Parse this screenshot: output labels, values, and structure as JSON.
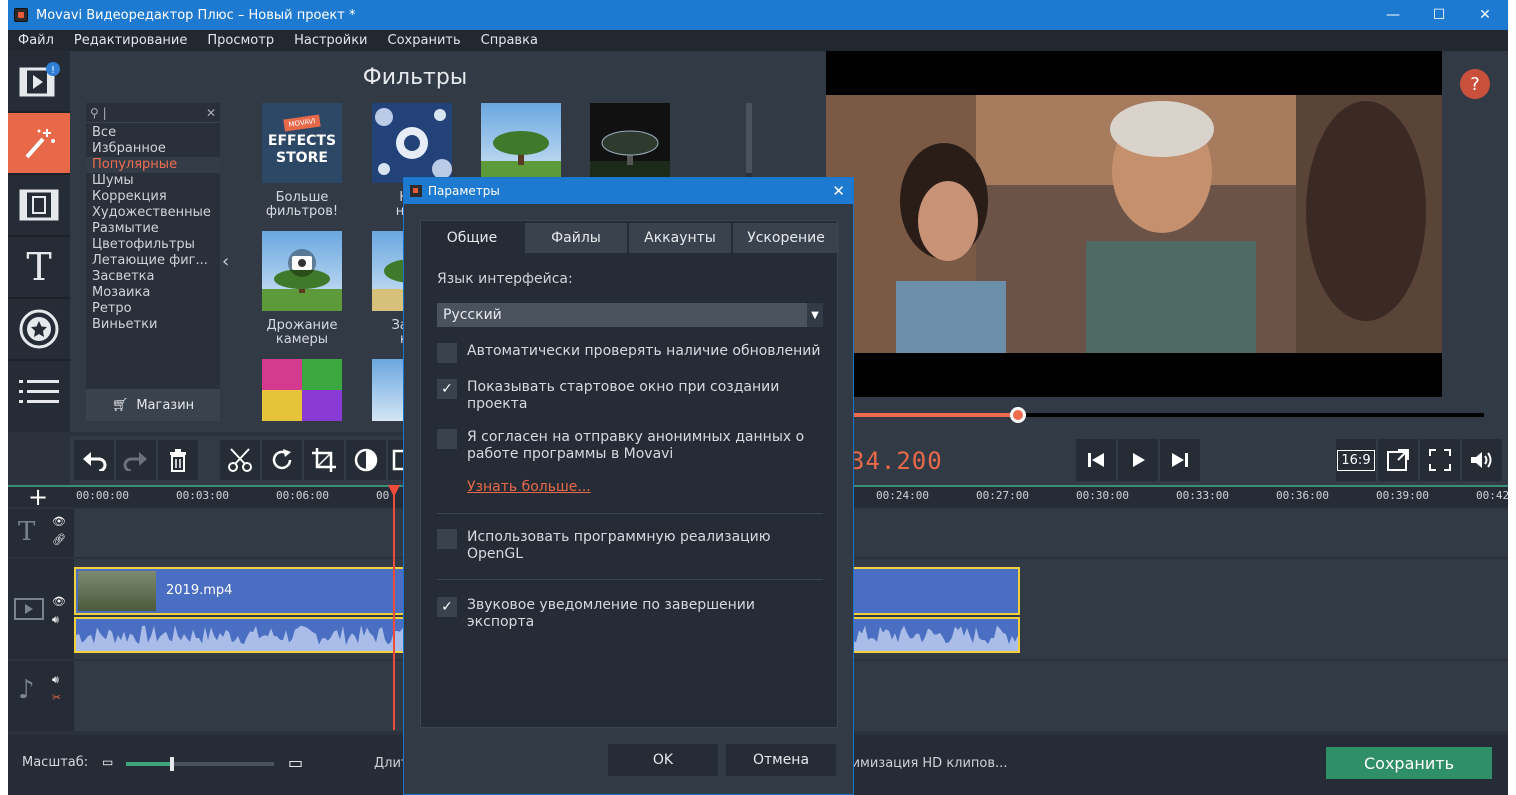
{
  "window": {
    "title": "Movavi Видеоредактор Плюс – Новый проект *",
    "minimize": "—",
    "maximize": "☐",
    "close": "✕"
  },
  "menu": [
    "Файл",
    "Редактирование",
    "Просмотр",
    "Настройки",
    "Сохранить",
    "Справка"
  ],
  "left_tools": [
    {
      "name": "import-icon",
      "badge": "!"
    },
    {
      "name": "filters-wand-icon"
    },
    {
      "name": "transitions-icon"
    },
    {
      "name": "titles-icon",
      "glyph": "T"
    },
    {
      "name": "stickers-star-icon"
    },
    {
      "name": "more-list-icon"
    }
  ],
  "filters": {
    "title": "Фильтры",
    "search_value": "|",
    "categories": [
      "Все",
      "Избранное",
      "Популярные",
      "Шумы",
      "Коррекция",
      "Художественные",
      "Размытие",
      "Цветофильтры",
      "Летающие фиг...",
      "Засветка",
      "Мозаика",
      "Ретро",
      "Виньетки"
    ],
    "selected_category": "Популярные",
    "store_label": "Магазин",
    "nav_prev": "‹",
    "store_thumb": {
      "brand": "MOVAVI",
      "line1": "EFFECTS",
      "line2": "STORE"
    },
    "thumbs": [
      {
        "label1": "Больше",
        "label2": "фильтров!"
      },
      {
        "label1": "Нов",
        "label2": "набо"
      },
      {
        "label1": "Дрожание",
        "label2": "камеры"
      },
      {
        "label1": "Запол",
        "label2": "кра"
      }
    ]
  },
  "preview": {
    "help": "?",
    "progress_fraction": 0.265,
    "timecode": "34.200",
    "aspect": "16:9"
  },
  "timeline": {
    "ruler": [
      "00:00:00",
      "00:03:00",
      "00:06:00",
      "00",
      "00:24:00",
      "00:27:00",
      "00:30:00",
      "00:33:00",
      "00:36:00",
      "00:39:00",
      "00:42"
    ],
    "clip_name": "2019.mp4",
    "add": "+"
  },
  "bottom": {
    "zoom_label": "Масштаб:",
    "zoom_fraction": 0.3,
    "duration_text": "Длит",
    "hd_text": "тимизация HD клипов...",
    "save_label": "Сохранить"
  },
  "dialog": {
    "title": "Параметры",
    "close": "✕",
    "tabs": [
      "Общие",
      "Файлы",
      "Аккаунты",
      "Ускорение"
    ],
    "active_tab": "Общие",
    "language_label": "Язык интерфейса:",
    "language_value": "Русский",
    "options": [
      {
        "text": "Автоматически проверять наличие обновлений",
        "checked": false
      },
      {
        "text": "Показывать стартовое окно при создании проекта",
        "checked": true
      },
      {
        "text": "Я согласен на отправку анонимных данных о работе программы в Movavi",
        "checked": false
      },
      {
        "text": "Использовать программную реализацию OpenGL",
        "checked": false
      },
      {
        "text": "Звуковое уведомление по завершении экспорта",
        "checked": true
      }
    ],
    "learn_more": "Узнать больше...",
    "ok": "OK",
    "cancel": "Отмена"
  }
}
